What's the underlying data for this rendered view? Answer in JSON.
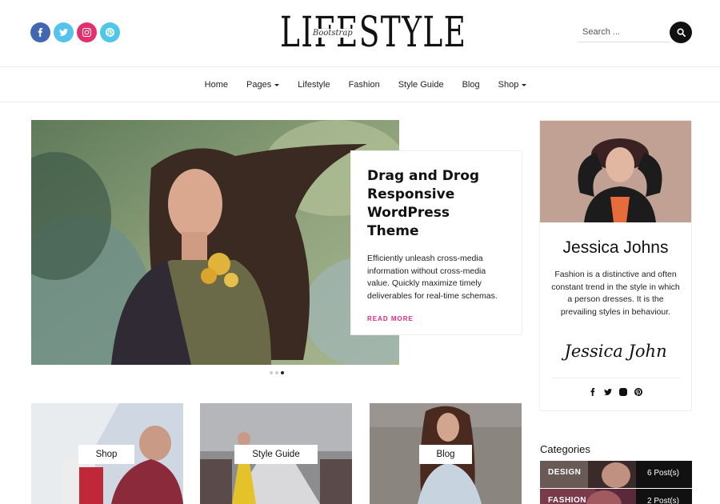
{
  "header": {
    "logo_main": "LIFESTYLE",
    "logo_script": "Bootstrap",
    "search_placeholder": "Search ...",
    "socials": [
      "facebook-icon",
      "twitter-icon",
      "instagram-icon",
      "pinterest-icon"
    ]
  },
  "nav": {
    "items": [
      {
        "label": "Home",
        "dropdown": false
      },
      {
        "label": "Pages",
        "dropdown": true
      },
      {
        "label": "Lifestyle",
        "dropdown": false
      },
      {
        "label": "Fashion",
        "dropdown": false
      },
      {
        "label": "Style Guide",
        "dropdown": false
      },
      {
        "label": "Blog",
        "dropdown": false
      },
      {
        "label": "Shop",
        "dropdown": true
      }
    ]
  },
  "hero": {
    "title": "Drag and Drog Responsive WordPress Theme",
    "excerpt": "Efficiently unleash cross-media information without cross-media value. Quickly maximize timely deliverables for real-time schemas.",
    "read_more": "READ MORE",
    "slides": 3,
    "active_slide": 3
  },
  "profile": {
    "name": "Jessica Johns",
    "bio": "Fashion is a distinctive and often constant trend in the style in which a person dresses. It is the prevailing styles in behaviour.",
    "signature": "Jessica John"
  },
  "categories": {
    "title": "Categories",
    "items": [
      {
        "name": "DESIGN",
        "count": "6 Post(s)"
      },
      {
        "name": "FASHION",
        "count": "2 Post(s)"
      }
    ]
  },
  "tiles": [
    {
      "label": "Shop"
    },
    {
      "label": "Style Guide"
    },
    {
      "label": "Blog"
    }
  ],
  "colors": {
    "accent": "#e0287b",
    "facebook": "#4267b2",
    "twitter": "#55c2ee",
    "instagram": "#e1306c",
    "pinterest": "#4fc7e9"
  }
}
